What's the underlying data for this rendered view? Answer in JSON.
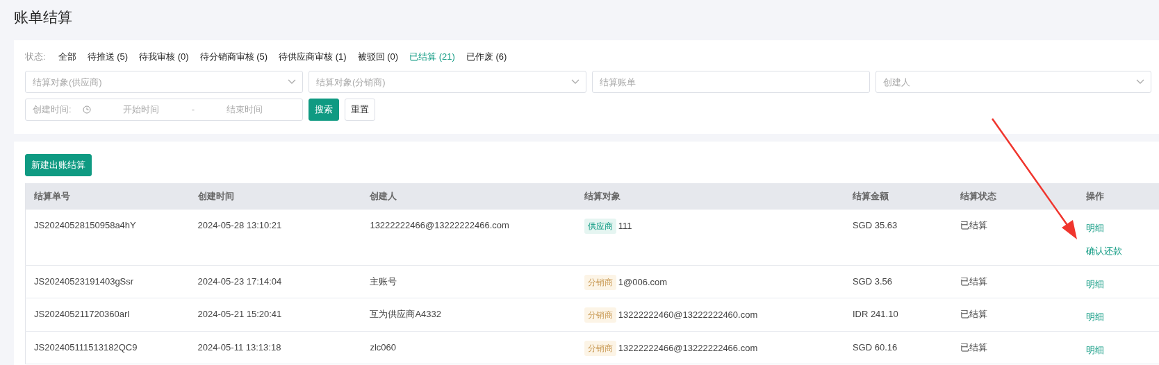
{
  "page_title": "账单结算",
  "status_filter": {
    "label": "状态:",
    "options": [
      {
        "label": "全部",
        "selected": false
      },
      {
        "label": "待推送 (5)",
        "selected": false
      },
      {
        "label": "待我审核 (0)",
        "selected": false
      },
      {
        "label": "待分销商审核 (5)",
        "selected": false
      },
      {
        "label": "待供应商审核 (1)",
        "selected": false
      },
      {
        "label": "被驳回 (0)",
        "selected": false
      },
      {
        "label": "已结算 (21)",
        "selected": true
      },
      {
        "label": "已作废 (6)",
        "selected": false
      }
    ]
  },
  "filters": [
    {
      "kind": "select",
      "placeholder": "结算对象(供应商)"
    },
    {
      "kind": "select",
      "placeholder": "结算对象(分销商)"
    },
    {
      "kind": "input",
      "placeholder": "结算账单"
    },
    {
      "kind": "select",
      "placeholder": "创建人"
    }
  ],
  "date_range": {
    "label": "创建时间:",
    "start_placeholder": "开始时间",
    "separator": "-",
    "end_placeholder": "结束时间"
  },
  "buttons": [
    {
      "label": "搜索",
      "kind": "primary"
    },
    {
      "label": "重置",
      "kind": "default"
    }
  ],
  "create_button": "新建出账结算",
  "table": {
    "columns": [
      "结算单号",
      "创建时间",
      "创建人",
      "结算对象",
      "结算金额",
      "结算状态",
      "操作"
    ],
    "rows": [
      {
        "number": "JS20240528150958a4hY",
        "created": "2024-05-28 13:10:21",
        "creator": "13222222466@13222222466.com",
        "target_tag": {
          "kind": "supplier",
          "label": "供应商"
        },
        "target": "111",
        "amount": "SGD 35.63",
        "status": "已结算",
        "actions": [
          "明细",
          "确认还款"
        ]
      },
      {
        "number": "JS20240523191403gSsr",
        "created": "2024-05-23 17:14:04",
        "creator": "主账号",
        "target_tag": {
          "kind": "distributor",
          "label": "分销商"
        },
        "target": "1@006.com",
        "amount": "SGD 3.56",
        "status": "已结算",
        "actions": [
          "明细"
        ]
      },
      {
        "number": "JS202405211720360arl",
        "created": "2024-05-21 15:20:41",
        "creator": "互为供应商A4332",
        "target_tag": {
          "kind": "distributor",
          "label": "分销商"
        },
        "target": "13222222460@13222222460.com",
        "amount": "IDR 241.10",
        "status": "已结算",
        "actions": [
          "明细"
        ]
      },
      {
        "number": "JS202405111513182QC9",
        "created": "2024-05-11 13:13:18",
        "creator": "zlc060",
        "target_tag": {
          "kind": "distributor",
          "label": "分销商"
        },
        "target": "13222222466@13222222466.com",
        "amount": "SGD 60.16",
        "status": "已结算",
        "actions": [
          "明细"
        ]
      }
    ]
  }
}
